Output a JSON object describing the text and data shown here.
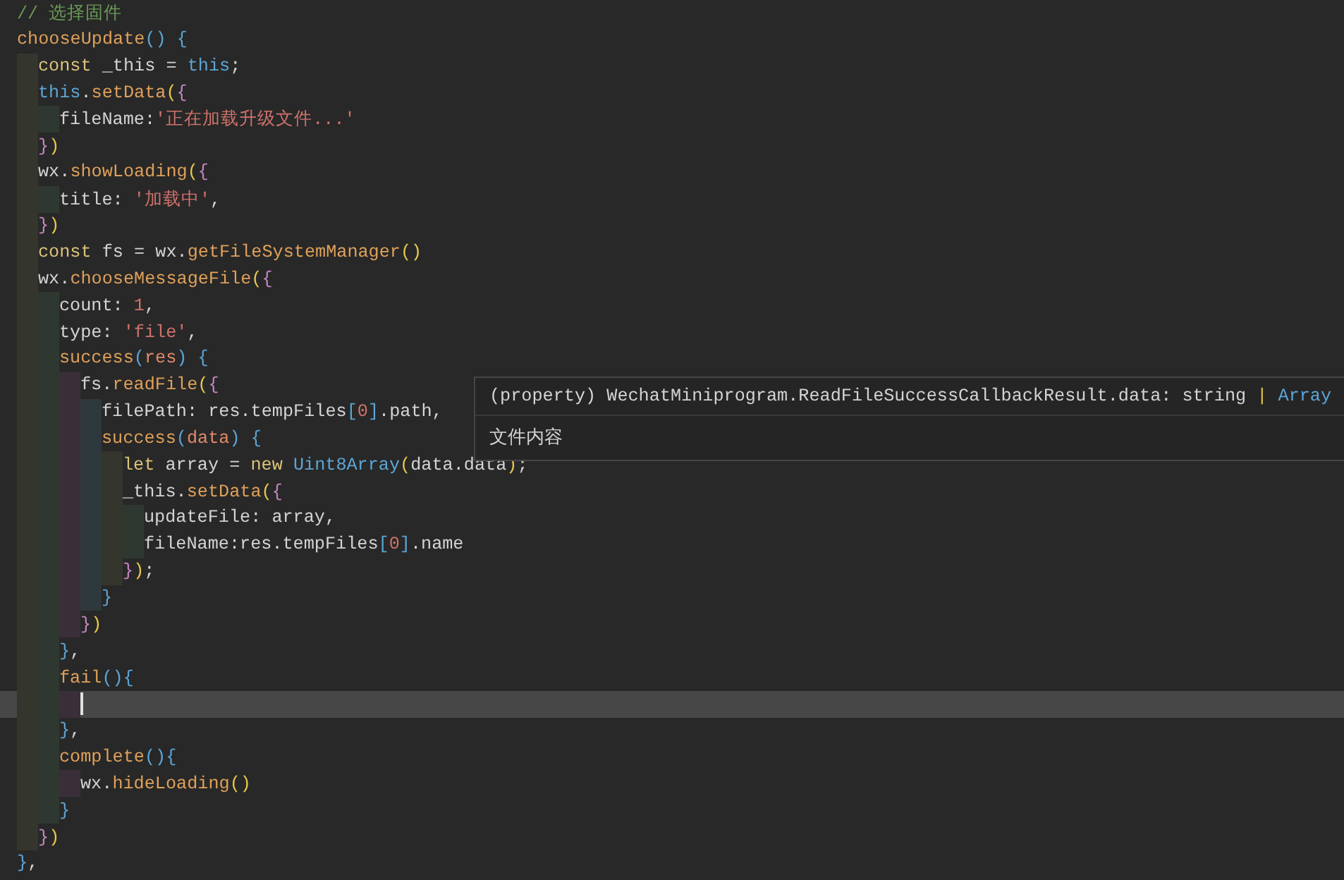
{
  "editor": {
    "lines": [
      {
        "current": false,
        "tokens": [
          {
            "kind": "comment",
            "text": "// 选择固件"
          }
        ]
      },
      {
        "current": false,
        "tokens": [
          {
            "kind": "func",
            "text": "chooseUpdate"
          },
          {
            "kind": "b3",
            "text": "()"
          },
          {
            "kind": "b3",
            "text": " {"
          }
        ],
        "children": [
          {
            "current": false,
            "tokens": [
              {
                "kind": "keyword",
                "text": "const"
              },
              {
                "kind": "plain",
                "text": " _this = "
              },
              {
                "kind": "this",
                "text": "this"
              },
              {
                "kind": "plain",
                "text": ";"
              }
            ]
          },
          {
            "current": false,
            "tokens": [
              {
                "kind": "this",
                "text": "this"
              },
              {
                "kind": "plain",
                "text": "."
              },
              {
                "kind": "func",
                "text": "setData"
              },
              {
                "kind": "b1",
                "text": "("
              },
              {
                "kind": "b2",
                "text": "{"
              }
            ],
            "children": [
              {
                "current": false,
                "tokens": [
                  {
                    "kind": "plain",
                    "text": "fileName:"
                  },
                  {
                    "kind": "string",
                    "text": "'正在加载升级文件...'"
                  }
                ]
              }
            ]
          },
          {
            "current": false,
            "tokens": [
              {
                "kind": "b2",
                "text": "}"
              },
              {
                "kind": "b1",
                "text": ")"
              }
            ]
          },
          {
            "current": false,
            "tokens": [
              {
                "kind": "plain",
                "text": "wx."
              },
              {
                "kind": "func",
                "text": "showLoading"
              },
              {
                "kind": "b1",
                "text": "("
              },
              {
                "kind": "b2",
                "text": "{"
              }
            ],
            "children": [
              {
                "current": false,
                "tokens": [
                  {
                    "kind": "plain",
                    "text": "title: "
                  },
                  {
                    "kind": "string",
                    "text": "'加载中'"
                  },
                  {
                    "kind": "plain",
                    "text": ","
                  }
                ]
              }
            ]
          },
          {
            "current": false,
            "tokens": [
              {
                "kind": "b2",
                "text": "}"
              },
              {
                "kind": "b1",
                "text": ")"
              }
            ]
          },
          {
            "current": false,
            "tokens": [
              {
                "kind": "keyword",
                "text": "const"
              },
              {
                "kind": "plain",
                "text": " fs = wx."
              },
              {
                "kind": "func",
                "text": "getFileSystemManager"
              },
              {
                "kind": "b1",
                "text": "()"
              }
            ]
          },
          {
            "current": false,
            "tokens": [
              {
                "kind": "plain",
                "text": "wx."
              },
              {
                "kind": "func",
                "text": "chooseMessageFile"
              },
              {
                "kind": "b1",
                "text": "("
              },
              {
                "kind": "b2",
                "text": "{"
              }
            ],
            "children": [
              {
                "current": false,
                "tokens": [
                  {
                    "kind": "plain",
                    "text": "count: "
                  },
                  {
                    "kind": "number",
                    "text": "1"
                  },
                  {
                    "kind": "plain",
                    "text": ","
                  }
                ]
              },
              {
                "current": false,
                "tokens": [
                  {
                    "kind": "plain",
                    "text": "type: "
                  },
                  {
                    "kind": "string",
                    "text": "'file'"
                  },
                  {
                    "kind": "plain",
                    "text": ","
                  }
                ]
              },
              {
                "current": false,
                "tokens": [
                  {
                    "kind": "func",
                    "text": "success"
                  },
                  {
                    "kind": "b3",
                    "text": "("
                  },
                  {
                    "kind": "param",
                    "text": "res"
                  },
                  {
                    "kind": "b3",
                    "text": ")"
                  },
                  {
                    "kind": "b3",
                    "text": " {"
                  }
                ],
                "children": [
                  {
                    "current": false,
                    "tokens": [
                      {
                        "kind": "plain",
                        "text": "fs."
                      },
                      {
                        "kind": "func",
                        "text": "readFile"
                      },
                      {
                        "kind": "b1",
                        "text": "("
                      },
                      {
                        "kind": "b2",
                        "text": "{"
                      }
                    ],
                    "children": [
                      {
                        "current": false,
                        "tokens": [
                          {
                            "kind": "plain",
                            "text": "filePath: res.tempFiles"
                          },
                          {
                            "kind": "b3",
                            "text": "["
                          },
                          {
                            "kind": "number",
                            "text": "0"
                          },
                          {
                            "kind": "b3",
                            "text": "]"
                          },
                          {
                            "kind": "plain",
                            "text": ".path,"
                          }
                        ]
                      },
                      {
                        "current": false,
                        "tokens": [
                          {
                            "kind": "func",
                            "text": "success"
                          },
                          {
                            "kind": "b3",
                            "text": "("
                          },
                          {
                            "kind": "param",
                            "text": "data"
                          },
                          {
                            "kind": "b3",
                            "text": ")"
                          },
                          {
                            "kind": "b3",
                            "text": " {"
                          }
                        ],
                        "children": [
                          {
                            "current": false,
                            "tokens": [
                              {
                                "kind": "keyword",
                                "text": "let"
                              },
                              {
                                "kind": "plain",
                                "text": " array = "
                              },
                              {
                                "kind": "keyword",
                                "text": "new"
                              },
                              {
                                "kind": "type",
                                "text": " Uint8Array"
                              },
                              {
                                "kind": "b1",
                                "text": "("
                              },
                              {
                                "kind": "plain",
                                "text": "data.data"
                              },
                              {
                                "kind": "b1",
                                "text": ")"
                              },
                              {
                                "kind": "plain",
                                "text": ";"
                              }
                            ]
                          },
                          {
                            "current": false,
                            "tokens": [
                              {
                                "kind": "plain",
                                "text": "_this."
                              },
                              {
                                "kind": "func",
                                "text": "setData"
                              },
                              {
                                "kind": "b1",
                                "text": "("
                              },
                              {
                                "kind": "b2",
                                "text": "{"
                              }
                            ],
                            "children": [
                              {
                                "current": false,
                                "tokens": [
                                  {
                                    "kind": "plain",
                                    "text": "updateFile: array,"
                                  }
                                ]
                              },
                              {
                                "current": false,
                                "tokens": [
                                  {
                                    "kind": "plain",
                                    "text": "fileName:res.tempFiles"
                                  },
                                  {
                                    "kind": "b3",
                                    "text": "["
                                  },
                                  {
                                    "kind": "number",
                                    "text": "0"
                                  },
                                  {
                                    "kind": "b3",
                                    "text": "]"
                                  },
                                  {
                                    "kind": "plain",
                                    "text": ".name"
                                  }
                                ]
                              }
                            ]
                          },
                          {
                            "current": false,
                            "tokens": [
                              {
                                "kind": "b2",
                                "text": "}"
                              },
                              {
                                "kind": "b1",
                                "text": ")"
                              },
                              {
                                "kind": "plain",
                                "text": ";"
                              }
                            ]
                          }
                        ]
                      },
                      {
                        "current": false,
                        "tokens": [
                          {
                            "kind": "b3",
                            "text": "}"
                          }
                        ]
                      }
                    ]
                  },
                  {
                    "current": false,
                    "tokens": [
                      {
                        "kind": "b2",
                        "text": "}"
                      },
                      {
                        "kind": "b1",
                        "text": ")"
                      }
                    ]
                  }
                ]
              },
              {
                "current": false,
                "tokens": [
                  {
                    "kind": "b3",
                    "text": "}"
                  },
                  {
                    "kind": "plain",
                    "text": ","
                  }
                ]
              },
              {
                "current": false,
                "tokens": [
                  {
                    "kind": "func",
                    "text": "fail"
                  },
                  {
                    "kind": "b3",
                    "text": "(){"
                  }
                ],
                "children": [
                  {
                    "current": true
                  }
                ]
              },
              {
                "current": false,
                "tokens": [
                  {
                    "kind": "b3",
                    "text": "}"
                  },
                  {
                    "kind": "plain",
                    "text": ","
                  }
                ]
              },
              {
                "current": false,
                "tokens": [
                  {
                    "kind": "func",
                    "text": "complete"
                  },
                  {
                    "kind": "b3",
                    "text": "(){"
                  }
                ],
                "children": [
                  {
                    "current": false,
                    "tokens": [
                      {
                        "kind": "plain",
                        "text": "wx."
                      },
                      {
                        "kind": "func",
                        "text": "hideLoading"
                      },
                      {
                        "kind": "b1",
                        "text": "()"
                      }
                    ]
                  }
                ]
              },
              {
                "current": false,
                "tokens": [
                  {
                    "kind": "b3",
                    "text": "}"
                  }
                ]
              }
            ]
          },
          {
            "current": false,
            "tokens": [
              {
                "kind": "b2",
                "text": "}"
              },
              {
                "kind": "b1",
                "text": ")"
              }
            ]
          }
        ]
      },
      {
        "current": false,
        "tokens": [
          {
            "kind": "b3",
            "text": "}"
          },
          {
            "kind": "plain",
            "text": ","
          }
        ]
      }
    ]
  },
  "hover_tooltip": {
    "signature": [
      {
        "kind": "plain",
        "text": "(property) WechatMiniprogram.ReadFileSuccessCallbackResult.data: string "
      },
      {
        "kind": "b1",
        "text": "|"
      },
      {
        "kind": "type",
        "text": " Array"
      }
    ],
    "doc": "文件内容"
  }
}
